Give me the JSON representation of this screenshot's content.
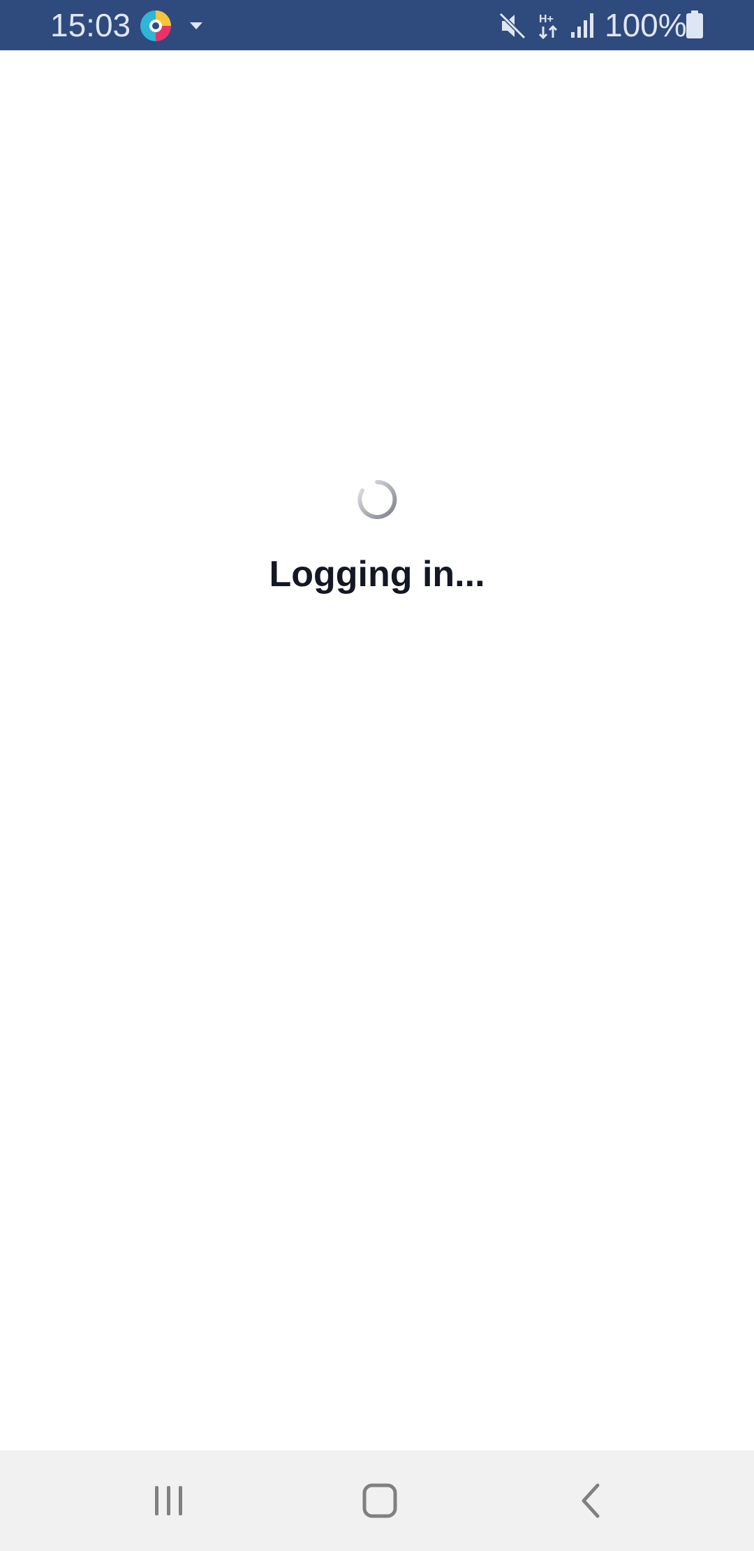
{
  "status_bar": {
    "time": "15:03",
    "battery": "100%",
    "icons": [
      "app-notification-icon",
      "dropdown-icon",
      "mute-icon",
      "data-hplus-icon",
      "signal-icon",
      "battery-icon"
    ]
  },
  "main": {
    "loading_text": "Logging in...",
    "spinner_icon": "loading-spinner-icon"
  },
  "nav_bar": {
    "buttons": [
      "recents",
      "home",
      "back"
    ]
  },
  "colors": {
    "status_bar_bg": "#2f4a7d",
    "text_primary": "#141824",
    "nav_bar_bg": "#f1f1f1"
  }
}
